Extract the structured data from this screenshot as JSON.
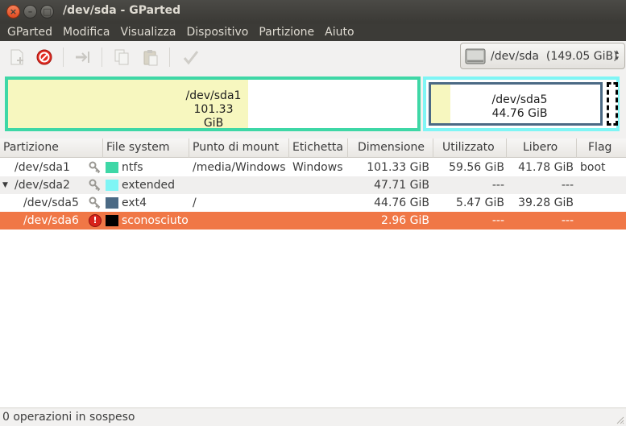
{
  "window": {
    "title": "/dev/sda - GParted"
  },
  "menubar": [
    "GParted",
    "Modifica",
    "Visualizza",
    "Dispositivo",
    "Partizione",
    "Aiuto"
  ],
  "toolbar": {
    "icons": [
      "new-partition-icon",
      "delete-partition-icon",
      "resize-move-icon",
      "copy-icon",
      "paste-icon",
      "apply-icon"
    ],
    "device_selector": {
      "device": "/dev/sda",
      "size": "(149.05 GiB)"
    }
  },
  "disk_map": {
    "sda1": {
      "name": "/dev/sda1",
      "size": "101.33 GiB",
      "color": "#3ed7a6"
    },
    "sda5": {
      "name": "/dev/sda5",
      "size": "44.76 GiB",
      "color": "#4b6a85"
    },
    "extended_color": "#7ff5f5"
  },
  "table": {
    "columns": [
      "Partizione",
      "File system",
      "Punto di mount",
      "Etichetta",
      "Dimensione",
      "Utilizzato",
      "Libero",
      "Flag"
    ],
    "rows": [
      {
        "partition": "/dev/sda1",
        "icon": "key-icon",
        "fs_color": "#3ed7a6",
        "fs": "ntfs",
        "mount": "/media/Windows",
        "label": "Windows",
        "size": "101.33 GiB",
        "used": "59.56 GiB",
        "free": "41.78 GiB",
        "flag": "boot"
      },
      {
        "partition": "/dev/sda2",
        "icon": "key-icon",
        "fs_color": "#7ff5f5",
        "fs": "extended",
        "mount": "",
        "label": "",
        "size": "47.71 GiB",
        "used": "---",
        "free": "---",
        "flag": ""
      },
      {
        "partition": "/dev/sda5",
        "icon": "key-icon",
        "fs_color": "#4b6a85",
        "fs": "ext4",
        "mount": "/",
        "label": "",
        "size": "44.76 GiB",
        "used": "5.47 GiB",
        "free": "39.28 GiB",
        "flag": ""
      },
      {
        "partition": "/dev/sda6",
        "icon": "warning-icon",
        "fs_color": "#000000",
        "fs": "sconosciuto",
        "mount": "",
        "label": "",
        "size": "2.96 GiB",
        "used": "---",
        "free": "---",
        "flag": ""
      }
    ]
  },
  "status": {
    "text": "0 operazioni in sospeso"
  }
}
